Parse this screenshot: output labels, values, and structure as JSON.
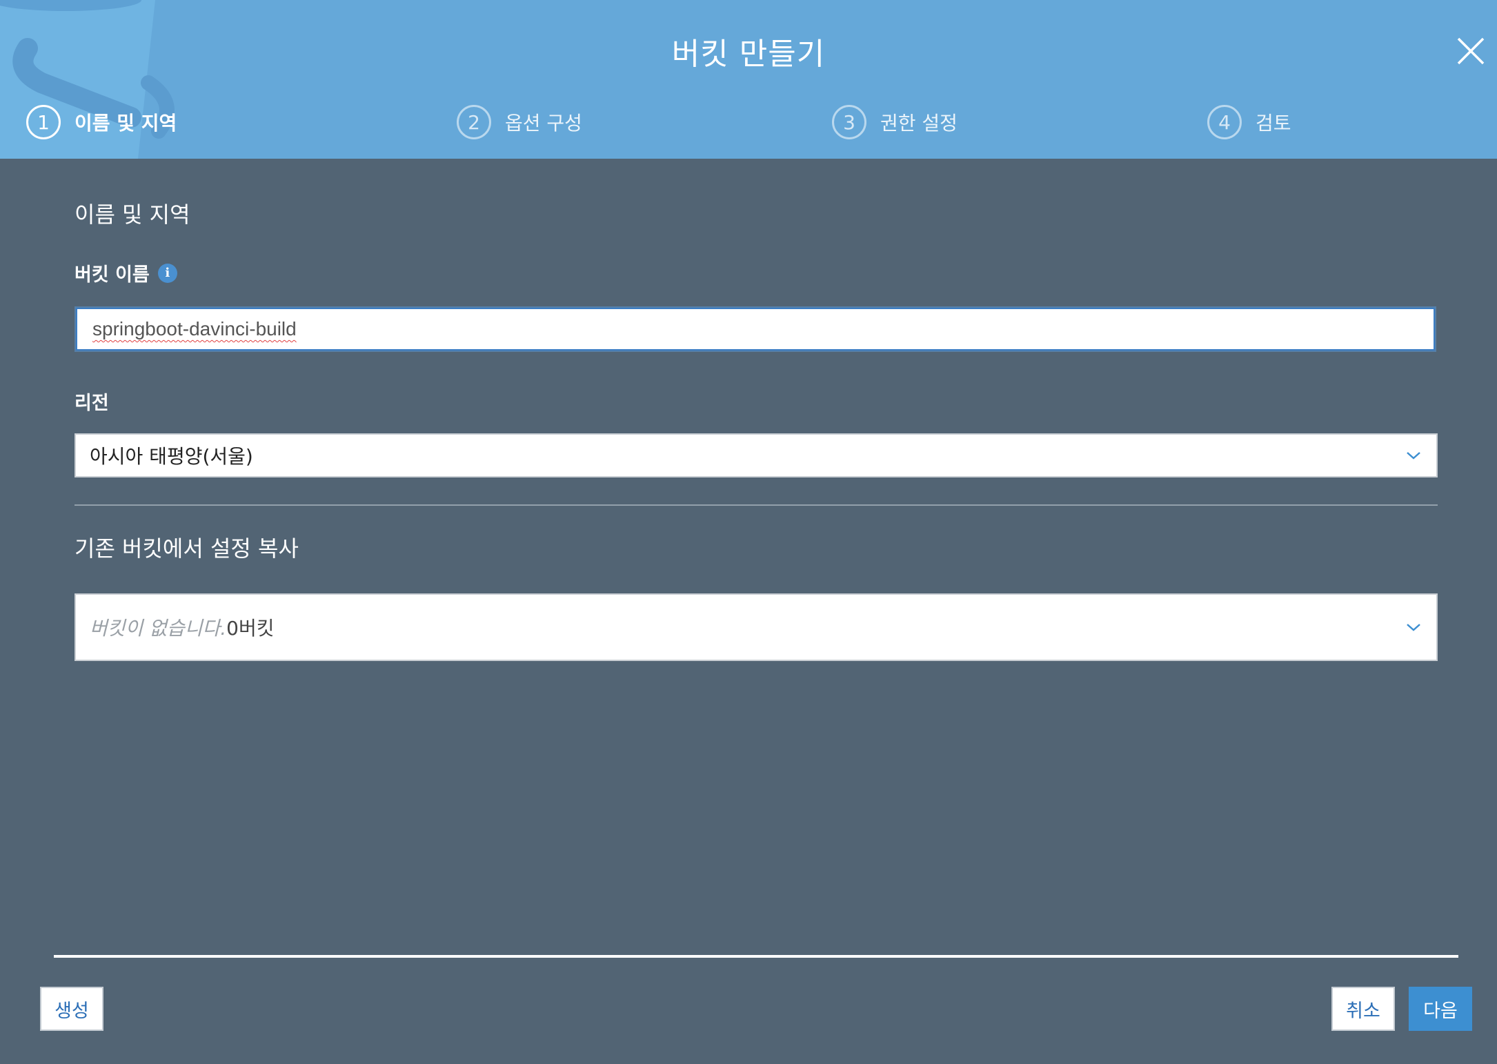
{
  "dialog": {
    "title": "버킷 만들기"
  },
  "steps": [
    {
      "number": "1",
      "label": "이름 및 지역",
      "active": true
    },
    {
      "number": "2",
      "label": "옵션 구성",
      "active": false
    },
    {
      "number": "3",
      "label": "권한 설정",
      "active": false
    },
    {
      "number": "4",
      "label": "검토",
      "active": false
    }
  ],
  "form": {
    "section_title": "이름 및 지역",
    "bucket_name_label": "버킷 이름",
    "bucket_name_value": "springboot-davinci-build",
    "region_label": "리전",
    "region_value": "아시아 태평양(서울)",
    "copy_section_title": "기존 버킷에서 설정 복사",
    "copy_placeholder": "버킷이 없습니다.",
    "copy_count": "0버킷"
  },
  "footer": {
    "create_label": "생성",
    "cancel_label": "취소",
    "next_label": "다음"
  },
  "colors": {
    "header": "#65a8d9",
    "body": "#526474",
    "accent": "#3d8fd1"
  },
  "icons": {
    "close": "close-icon",
    "info": "info-icon",
    "chevron": "chevron-down-icon"
  }
}
